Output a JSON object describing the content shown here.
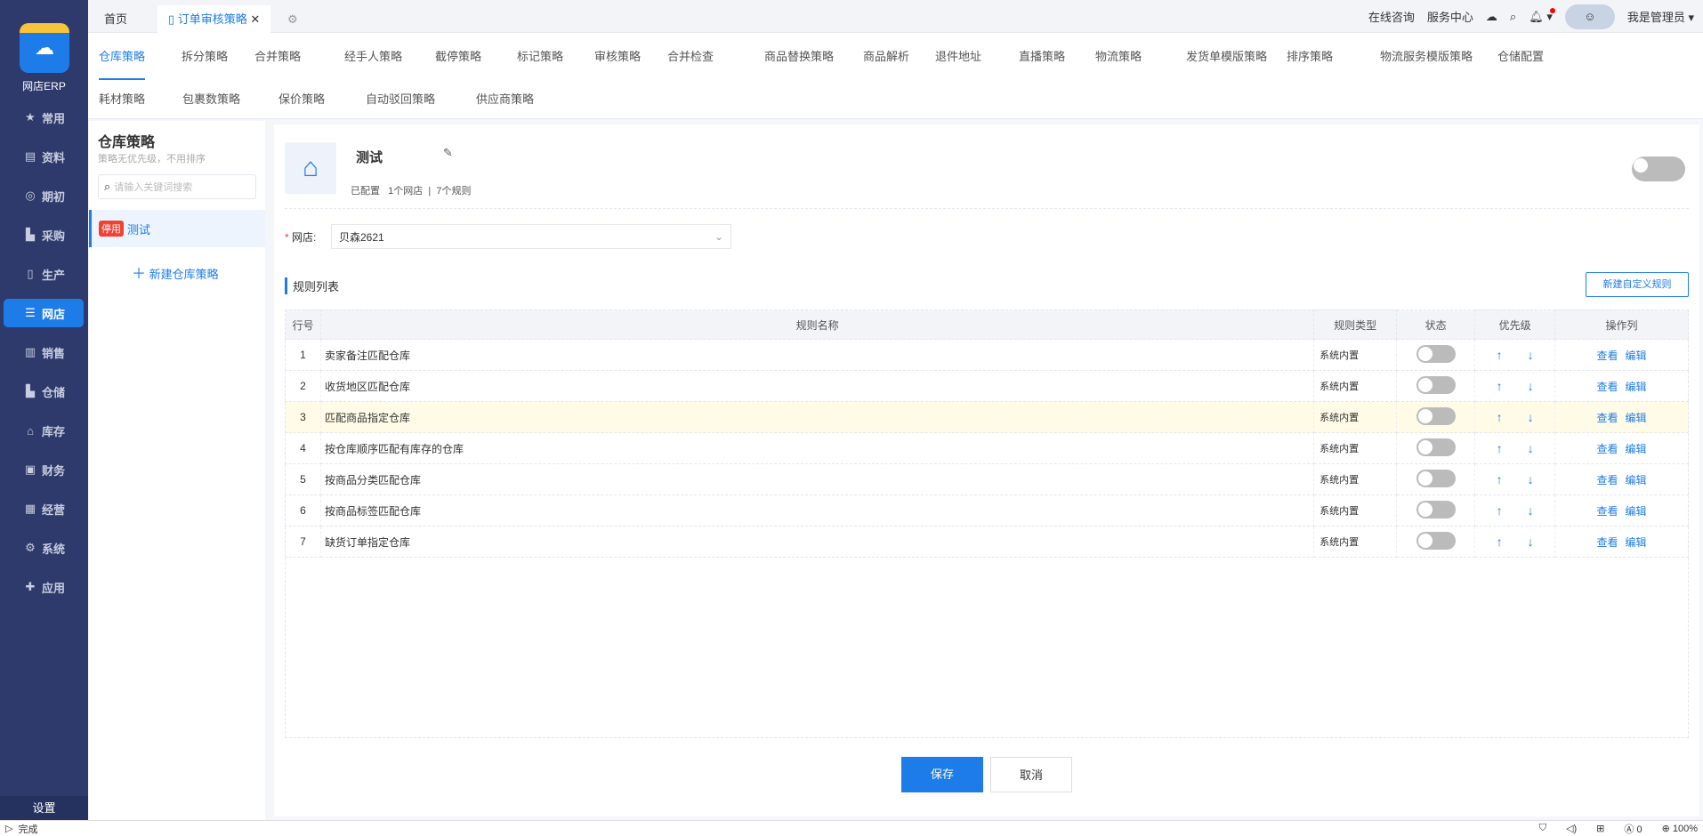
{
  "app": {
    "logo_text": "网店ERP",
    "settings": "设置"
  },
  "nav": [
    {
      "label": "常用",
      "icon": "★"
    },
    {
      "label": "资料",
      "icon": "▤"
    },
    {
      "label": "期初",
      "icon": "◎"
    },
    {
      "label": "采购",
      "icon": "▙"
    },
    {
      "label": "生产",
      "icon": "▯"
    },
    {
      "label": "网店",
      "icon": "☰"
    },
    {
      "label": "销售",
      "icon": "▥"
    },
    {
      "label": "仓储",
      "icon": "▙"
    },
    {
      "label": "库存",
      "icon": "⌂"
    },
    {
      "label": "财务",
      "icon": "▣"
    },
    {
      "label": "经营",
      "icon": "▦"
    },
    {
      "label": "系统",
      "icon": "⚙"
    },
    {
      "label": "应用",
      "icon": "✚"
    }
  ],
  "tabs": {
    "home": "首页",
    "active": "订单审核策略"
  },
  "topright": {
    "consult": "在线咨询",
    "service": "服务中心",
    "user": "我是管理员"
  },
  "subnav": {
    "row1": [
      "仓库策略",
      "拆分策略",
      "合并策略",
      "经手人策略",
      "截停策略",
      "标记策略",
      "审核策略",
      "合并检查",
      "商品替换策略",
      "商品解析",
      "退件地址",
      "直播策略",
      "物流策略",
      "发货单模版策略",
      "排序策略",
      "物流服务模版策略",
      "仓储配置"
    ],
    "row2": [
      "耗材策略",
      "包裹数策略",
      "保价策略",
      "自动驳回策略",
      "供应商策略"
    ]
  },
  "left": {
    "title": "仓库策略",
    "subtitle": "策略无优先级，不用排序",
    "search_placeholder": "请输入关键词搜索",
    "item_badge": "停用",
    "item_name": "测试",
    "new_label": "新建仓库策略"
  },
  "strategy": {
    "name": "测试",
    "configured": "已配置",
    "shops": "1个网店",
    "rules": "7个规则",
    "enabled": false
  },
  "form": {
    "shop_label": "网店:",
    "shop_value": "贝森2621"
  },
  "rules": {
    "title": "规则列表",
    "new_button": "新建自定义规则",
    "columns": [
      "行号",
      "规则名称",
      "规则类型",
      "状态",
      "优先级",
      "操作列"
    ],
    "rows": [
      {
        "no": "1",
        "name": "卖家备注匹配仓库",
        "type": "系统内置"
      },
      {
        "no": "2",
        "name": "收货地区匹配仓库",
        "type": "系统内置"
      },
      {
        "no": "3",
        "name": "匹配商品指定仓库",
        "type": "系统内置"
      },
      {
        "no": "4",
        "name": "按仓库顺序匹配有库存的仓库",
        "type": "系统内置"
      },
      {
        "no": "5",
        "name": "按商品分类匹配仓库",
        "type": "系统内置"
      },
      {
        "no": "6",
        "name": "按商品标签匹配仓库",
        "type": "系统内置"
      },
      {
        "no": "7",
        "name": "缺货订单指定仓库",
        "type": "系统内置"
      }
    ],
    "view": "查看",
    "edit": "编辑"
  },
  "actions": {
    "save": "保存",
    "cancel": "取消"
  },
  "statusbar": {
    "text": "完成",
    "ad_count": "0",
    "zoom": "100%"
  }
}
